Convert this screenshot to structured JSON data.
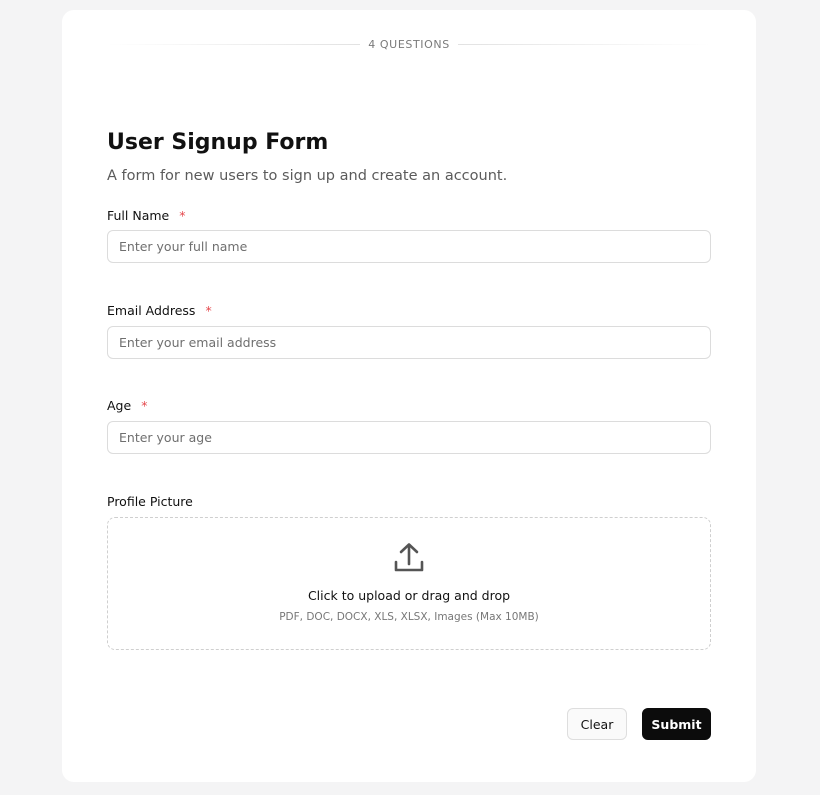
{
  "header": {
    "question_count_label": "4 QUESTIONS"
  },
  "form": {
    "title": "User Signup Form",
    "description": "A form for new users to sign up and create an account.",
    "required_marker": "*",
    "fields": [
      {
        "label": "Full Name",
        "required": true,
        "placeholder": "Enter your full name",
        "value": ""
      },
      {
        "label": "Email Address",
        "required": true,
        "placeholder": "Enter your email address",
        "value": ""
      },
      {
        "label": "Age",
        "required": true,
        "placeholder": "Enter your age",
        "value": ""
      },
      {
        "label": "Profile Picture",
        "required": false
      }
    ],
    "upload": {
      "icon": "upload-icon",
      "title": "Click to upload or drag and drop",
      "hint": "PDF, DOC, DOCX, XLS, XLSX, Images (Max 10MB)"
    }
  },
  "actions": {
    "clear_label": "Clear",
    "submit_label": "Submit"
  },
  "colors": {
    "required": "#e5484d",
    "primary_button": "#0c0c0c",
    "page_background": "#f4f4f5"
  }
}
